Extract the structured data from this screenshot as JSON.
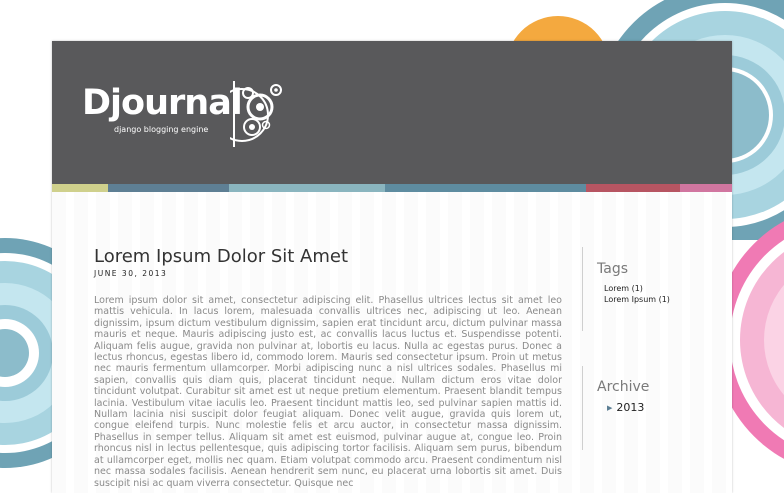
{
  "site": {
    "logo_text": "Djournal",
    "logo_tagline": "django blogging engine"
  },
  "colors": {
    "header": "#59595b",
    "stripes": [
      "#cfd08c",
      "#5e7f94",
      "#8ab5bf",
      "#5e8ca0",
      "#b75562",
      "#d176a0"
    ],
    "disc_blue": "#7ab5c7",
    "disc_orange": "#f4a93f",
    "disc_pink": "#f07ab4"
  },
  "post": {
    "title": "Lorem Ipsum Dolor Sit Amet",
    "date": "JUNE 30, 2013",
    "body": "Lorem ipsum dolor sit amet, consectetur adipiscing elit. Phasellus ultrices lectus sit amet leo mattis vehicula. In lacus lorem, malesuada convallis ultrices nec, adipiscing ut leo. Aenean dignissim, ipsum dictum vestibulum dignissim, sapien erat tincidunt arcu, dictum pulvinar massa mauris et neque. Mauris adipiscing justo est, ac convallis lacus luctus et. Suspendisse potenti. Aliquam felis augue, gravida non pulvinar at, lobortis eu lacus. Nulla ac egestas purus. Donec a lectus rhoncus, egestas libero id, commodo lorem. Mauris sed consectetur ipsum. Proin ut metus nec mauris fermentum ullamcorper. Morbi adipiscing nunc a nisl ultrices sodales. Phasellus mi sapien, convallis quis diam quis, placerat tincidunt neque. Nullam dictum eros vitae dolor tincidunt volutpat. Curabitur sit amet est ut neque pretium elementum. Praesent blandit tempus lacinia. Vestibulum vitae iaculis leo. Praesent tincidunt mattis leo, sed pulvinar sapien mattis id. Nullam lacinia nisi suscipit dolor feugiat aliquam. Donec velit augue, gravida quis lorem ut, congue eleifend turpis. Nunc molestie felis et arcu auctor, in consectetur massa dignissim. Phasellus in semper tellus. Aliquam sit amet est euismod, pulvinar augue at, congue leo. Proin rhoncus nisl in lectus pellentesque, quis adipiscing tortor facilisis. Aliquam sem purus, bibendum at ullamcorper eget, mollis nec quam. Etiam volutpat commodo arcu. Praesent condimentum nisl nec massa sodales facilisis. Aenean hendrerit sem nunc, eu placerat urna lobortis sit amet. Duis suscipit nisi ac quam viverra consectetur. Quisque nec"
  },
  "sidebar": {
    "tags_heading": "Tags",
    "tags": [
      {
        "label": "Lorem (1)"
      },
      {
        "label": "Lorem Ipsum (1)"
      }
    ],
    "archive_heading": "Archive",
    "archive": [
      {
        "label": "2013"
      }
    ]
  }
}
